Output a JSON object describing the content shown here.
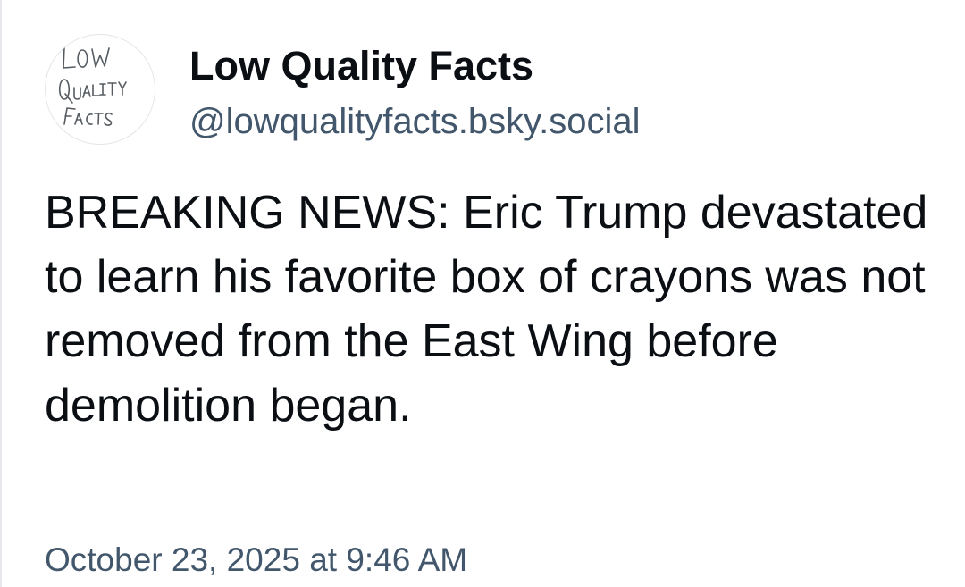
{
  "author": {
    "display_name": "Low Quality Facts",
    "handle": "@lowqualityfacts.bsky.social",
    "avatar": {
      "icon": "low-quality-facts-logo",
      "logo_text": [
        "LOW",
        "QUALITY",
        "FACTS"
      ]
    }
  },
  "post": {
    "text": "BREAKING NEWS: Eric Trump devastated to learn his favorite box of crayons was not removed from the East Wing before demolition began.",
    "timestamp": "October 23, 2025 at 9:46 AM"
  },
  "colors": {
    "text_primary": "#0b0f14",
    "text_secondary": "#42576c",
    "background": "#ffffff",
    "border": "#e6e8eb"
  }
}
